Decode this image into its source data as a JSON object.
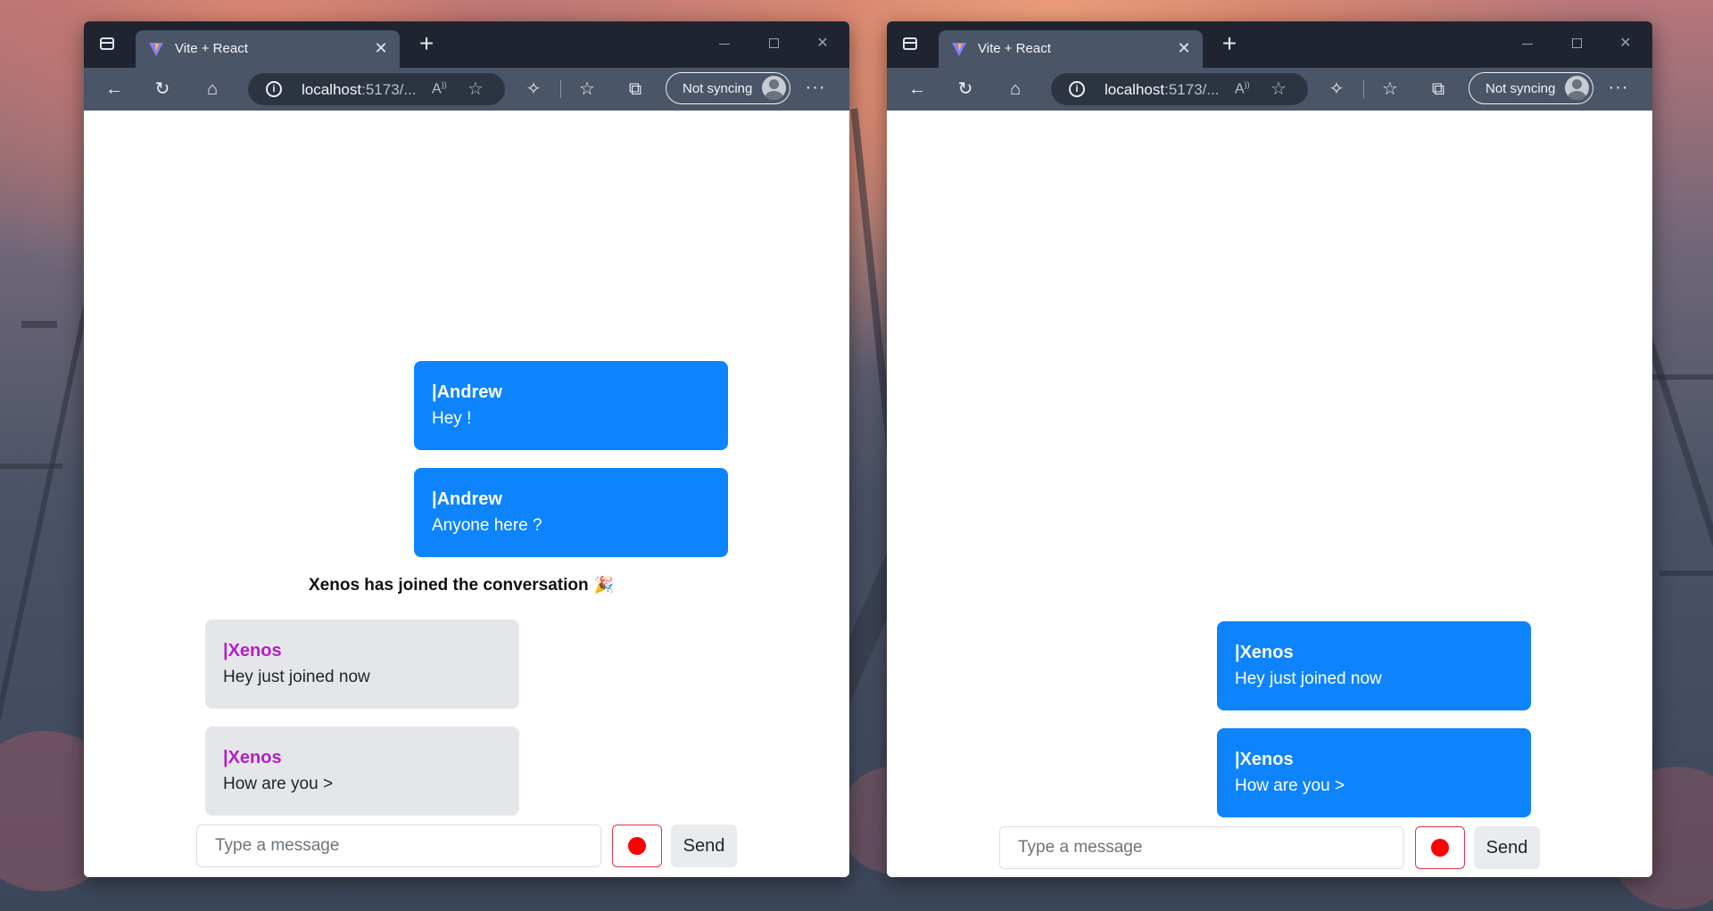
{
  "browsers": [
    {
      "tab_title": "Vite + React",
      "url": "localhost",
      "url_rest": ":5173/...",
      "sync_label": "Not syncing",
      "messages": [
        {
          "name": "|Andrew",
          "text": "Hey !",
          "side": "out"
        },
        {
          "name": "|Andrew",
          "text": "Anyone here ?",
          "side": "out"
        },
        {
          "name": "|Xenos",
          "text": "Hey just joined now",
          "side": "in"
        },
        {
          "name": "|Xenos",
          "text": "How are you >",
          "side": "in"
        }
      ],
      "system_message": "Xenos has joined the conversation",
      "input_placeholder": "Type a message",
      "send_label": "Send"
    },
    {
      "tab_title": "Vite + React",
      "url": "localhost",
      "url_rest": ":5173/...",
      "sync_label": "Not syncing",
      "messages": [
        {
          "name": "|Xenos",
          "text": "Hey just joined now",
          "side": "out"
        },
        {
          "name": "|Xenos",
          "text": "How are you >",
          "side": "out"
        }
      ],
      "input_placeholder": "Type a message",
      "send_label": "Send"
    }
  ],
  "colors": {
    "outgoing_bubble": "#0d84fb",
    "incoming_bubble": "#e5e6ea",
    "incoming_name": "#b31ec4",
    "record_border": "#dc3545",
    "record_dot": "#ff0000",
    "browser_chrome": "#4a5568"
  },
  "icons": {
    "tab_actions": "tab-actions-icon",
    "favicon": "vite-logo-icon",
    "back": "back-arrow-icon",
    "refresh": "refresh-icon",
    "home": "home-icon",
    "info": "info-icon",
    "read_aloud": "read-aloud-icon",
    "add_favorite": "add-favorite-icon",
    "extensions": "extensions-icon",
    "favorites": "favorites-icon",
    "collections": "collections-icon",
    "profile": "avatar",
    "more": "more-icon",
    "party": "party-popper-icon",
    "record": "record-dot-icon"
  }
}
